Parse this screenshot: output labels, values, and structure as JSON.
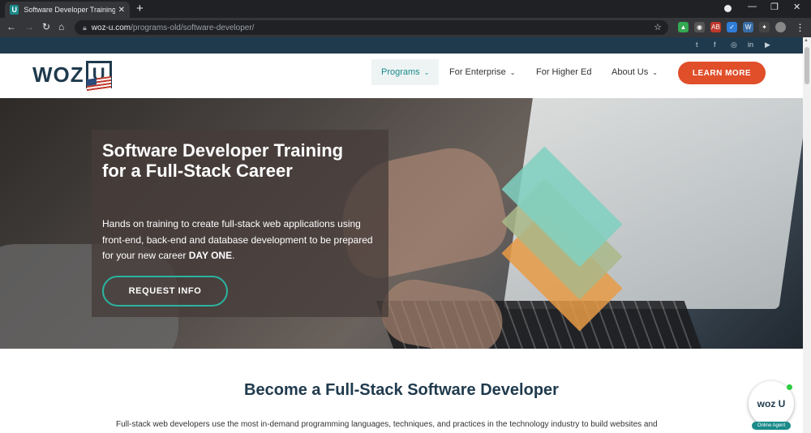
{
  "browser": {
    "tab_title": "Software Developer Training Onl",
    "tab_favicon": "U",
    "url_host": "woz-u.com",
    "url_path": "/programs-old/software-developer/"
  },
  "social": [
    "twitter-icon",
    "facebook-icon",
    "instagram-icon",
    "linkedin-icon",
    "youtube-icon"
  ],
  "social_glyphs": {
    "twitter": "t",
    "facebook": "f",
    "instagram": "◎",
    "linkedin": "in",
    "youtube": "▶"
  },
  "header": {
    "logo_text": "WOZ",
    "logo_u": "U",
    "nav": {
      "programs": "Programs",
      "enterprise": "For Enterprise",
      "higher_ed": "For Higher Ed",
      "about": "About Us"
    },
    "cta": "LEARN MORE"
  },
  "hero": {
    "title": "Software Developer Training for a Full-Stack Career",
    "lead_a": "Hands on training to create full-stack web applications using front-end, back-end and database development to be prepared for your new career ",
    "lead_bold": "DAY ONE",
    "lead_end": ".",
    "button": "REQUEST INFO"
  },
  "section": {
    "title": "Become a Full-Stack Software Developer",
    "text": "Full-stack web developers use the most in-demand programming languages, techniques, and practices in the technology industry to build websites and"
  },
  "agent": {
    "logo": "woz U",
    "badge": "Online Agent"
  },
  "colors": {
    "brand_navy": "#1f3a4d",
    "accent_orange": "#e04e2a",
    "teal": "#1a8a8a",
    "diamond_teal": "#7fd1c1",
    "diamond_olive": "#a9b98a",
    "diamond_orange": "#e79b45"
  }
}
